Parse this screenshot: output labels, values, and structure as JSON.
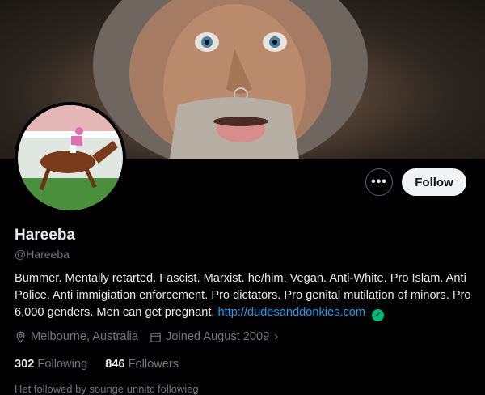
{
  "profile": {
    "display_name": "Hareeba",
    "handle": "@Hareeba",
    "bio_text": "Bummer. Mentally retarted. Fascist. Marxist. he/him. Vegan. Anti-White. Pro Islam. Anti Police. Anti immigiation enforcement. Pro dictators. Pro genital mutilation of minors. Pro 6,000 genders. Men can get pregnant.",
    "bio_link": "http://dudesanddonkies.com",
    "location": "Melbourne, Australia",
    "joined": "Joined August 2009",
    "following_count": "302",
    "following_label": "Following",
    "followers_count": "846",
    "followers_label": "Followers",
    "followed_by": "Het followed by sounge unnitc followieg"
  },
  "actions": {
    "more_label": "•••",
    "follow_label": "Follow"
  },
  "icons": {
    "more": "more-icon",
    "verified": "verified-check-icon",
    "location": "location-pin-icon",
    "calendar": "calendar-icon",
    "chevron": "chevron-right-icon"
  },
  "colors": {
    "background": "#000000",
    "text": "#e7e9ea",
    "muted": "#71767b",
    "link": "#1d9bf0",
    "verified": "#00ba7c",
    "follow_button": "#eff3f4"
  }
}
